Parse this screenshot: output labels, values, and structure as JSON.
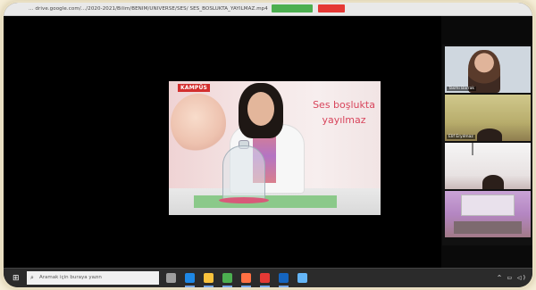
{
  "browser": {
    "url": "... drive.google.com/.../2020-2021/Bilim/BENIM/UNIVERSE/SES/ SES_BOSLUKTA_YAYILMAZ.mp4",
    "share_button": "",
    "stop_button": "",
    "extra": ""
  },
  "shared_screen": {
    "brand_badge": "KAMPÜS",
    "caption_line1": "Ses boşlukta",
    "caption_line2": "yayılmaz"
  },
  "participants": [
    {
      "name": "Tasmi Barrak",
      "icon": "video-participant"
    },
    {
      "name": "Elif Eryılmaz",
      "icon": "video-participant"
    },
    {
      "name": "",
      "icon": "video-participant"
    },
    {
      "name": "",
      "icon": "video-participant"
    }
  ],
  "taskbar": {
    "search_placeholder": "Aramak için buraya yazın",
    "apps": [
      {
        "name": "task-view-icon",
        "color": "#9e9e9e"
      },
      {
        "name": "edge-icon",
        "color": "#1e88e5"
      },
      {
        "name": "file-explorer-icon",
        "color": "#f9c23c"
      },
      {
        "name": "chrome-icon",
        "color": "#4caf50"
      },
      {
        "name": "media-player-icon",
        "color": "#ff7043"
      },
      {
        "name": "office-icon",
        "color": "#e53935"
      },
      {
        "name": "mail-icon",
        "color": "#1565c0"
      },
      {
        "name": "store-icon",
        "color": "#64b5f6"
      }
    ],
    "tray": "^ ▭ ◁)"
  }
}
